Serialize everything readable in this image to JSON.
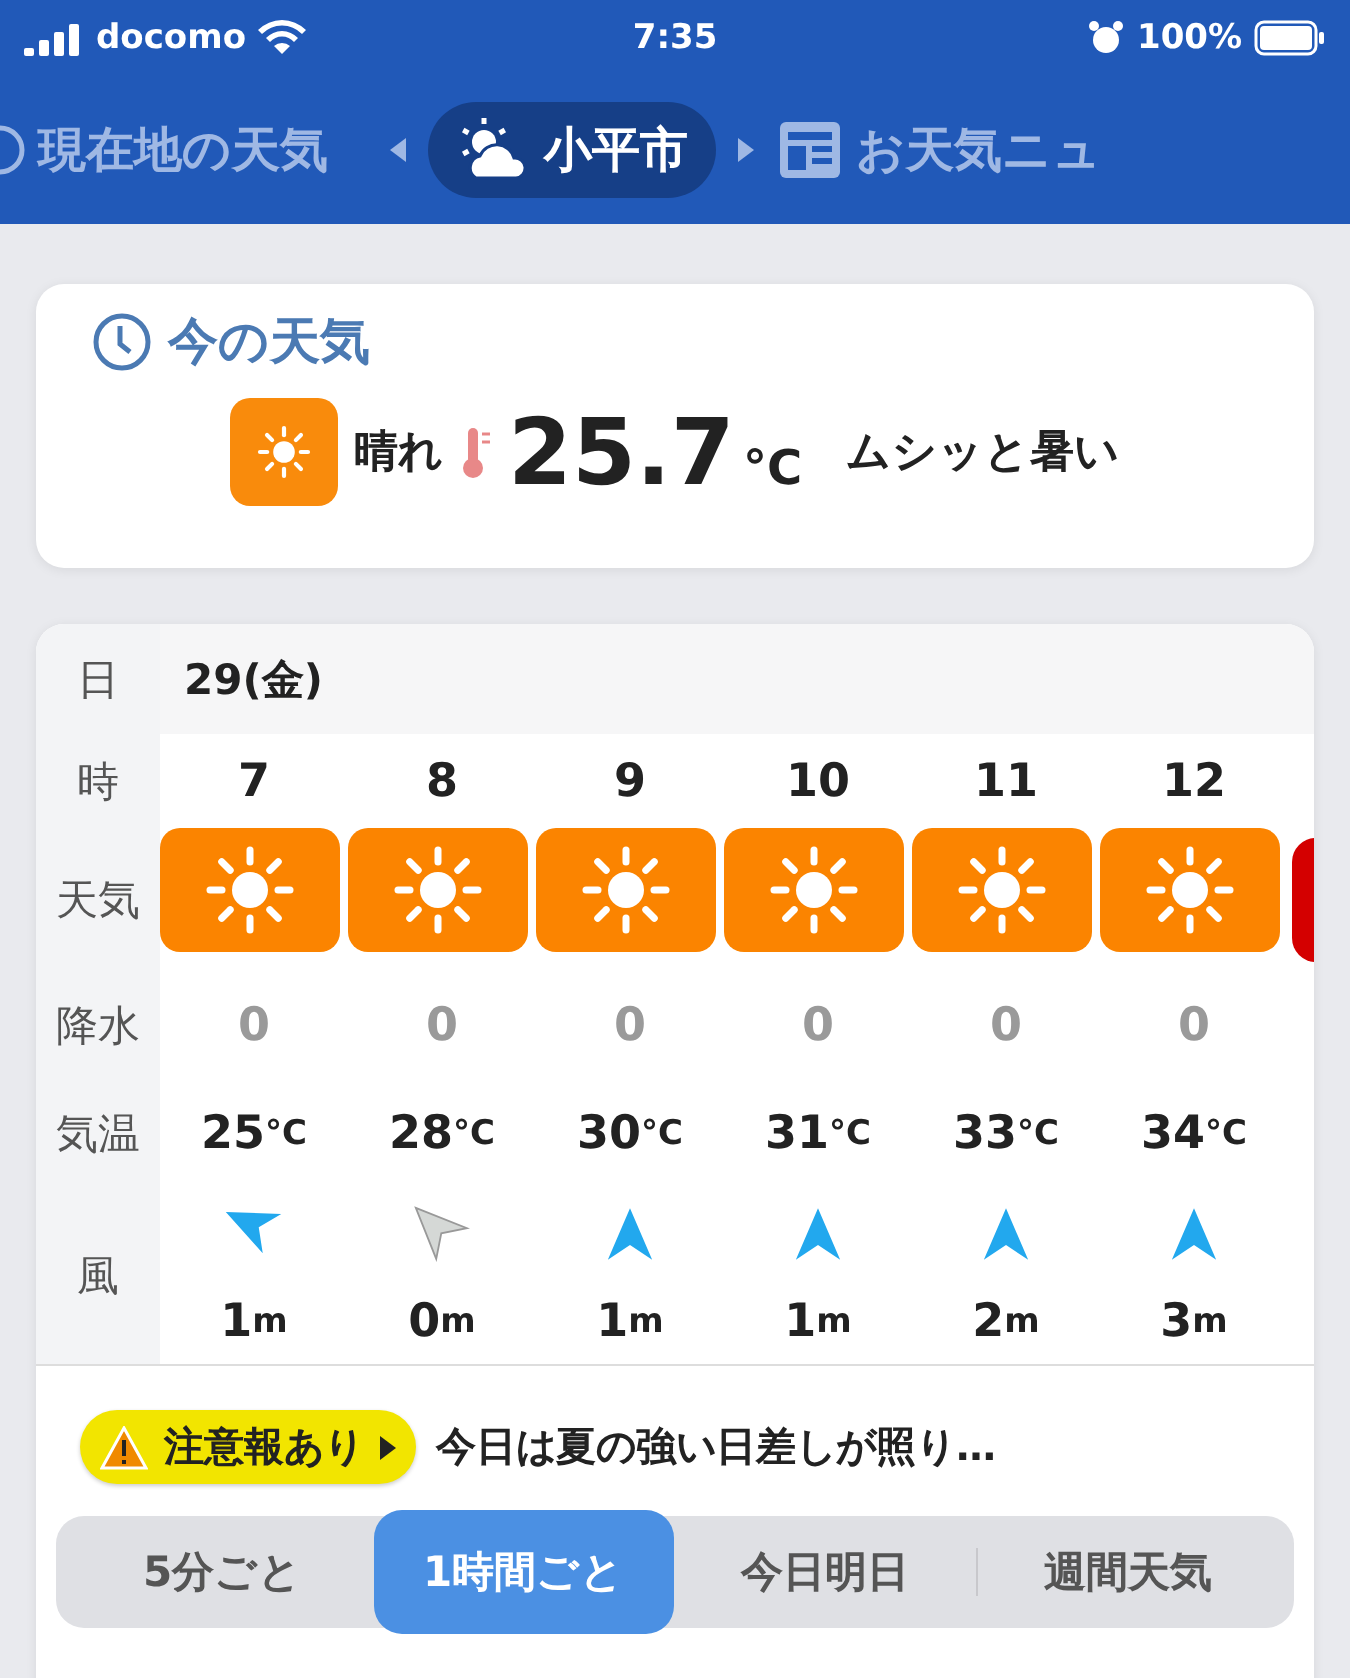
{
  "status_bar": {
    "carrier": "docomo",
    "time": "7:35",
    "battery": "100%"
  },
  "nav": [
    {
      "label": "現在地の天気",
      "selected": false
    },
    {
      "label": "小平市",
      "selected": true
    },
    {
      "label": "お天気ニュ",
      "selected": false
    }
  ],
  "current": {
    "title": "今の天気",
    "condition": "晴れ",
    "temp": "25.7",
    "unit": "°C",
    "comment": "ムシッと暑い"
  },
  "table": {
    "labels": {
      "date": "日",
      "hour": "時",
      "weather": "天気",
      "precip": "降水",
      "temp": "気温",
      "wind": "風"
    },
    "date": "29(金)",
    "hours": [
      {
        "hour": "7",
        "color": "#fb8400",
        "precip": "0",
        "temp": "25",
        "temp_unit": "°C",
        "kind": "breeze",
        "wind": "1",
        "wind_unit": "m"
      },
      {
        "hour": "8",
        "color": "#fb8400",
        "precip": "0",
        "temp": "28",
        "temp_unit": "°C",
        "kind": "calm",
        "wind": "0",
        "wind_unit": "m"
      },
      {
        "hour": "9",
        "color": "#fb8400",
        "precip": "0",
        "temp": "30",
        "temp_unit": "°C",
        "kind": "north",
        "wind": "1",
        "wind_unit": "m"
      },
      {
        "hour": "10",
        "color": "#fb8400",
        "precip": "0",
        "temp": "31",
        "temp_unit": "°C",
        "kind": "north",
        "wind": "1",
        "wind_unit": "m"
      },
      {
        "hour": "11",
        "color": "#fb8400",
        "precip": "0",
        "temp": "33",
        "temp_unit": "°C",
        "kind": "north",
        "wind": "2",
        "wind_unit": "m"
      },
      {
        "hour": "12",
        "color": "#fb8400",
        "precip": "0",
        "temp": "34",
        "temp_unit": "°C",
        "kind": "north",
        "wind": "3",
        "wind_unit": "m"
      }
    ],
    "partial_cell": {
      "color": "#d40000"
    }
  },
  "alert": {
    "badge": "注意報あり",
    "text": "今日は夏の強い日差しが照り…"
  },
  "tabs": [
    {
      "label": "5分ごと",
      "selected": false
    },
    {
      "label": "1時間ごと",
      "selected": true
    },
    {
      "label": "今日明日",
      "selected": false
    },
    {
      "label": "週間天気",
      "selected": false
    }
  ]
}
